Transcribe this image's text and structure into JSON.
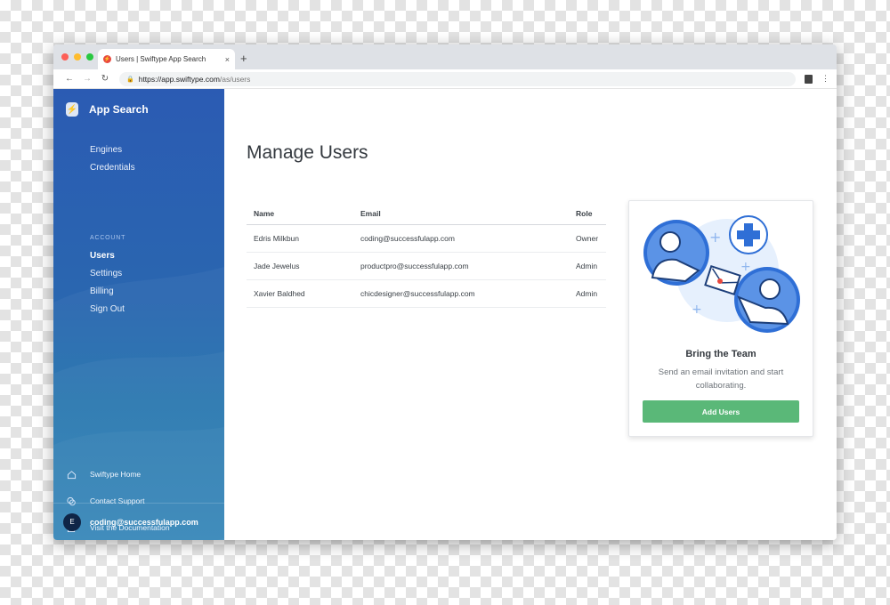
{
  "browser": {
    "tab_title": "Users | Swiftype App Search",
    "tab_close": "×",
    "new_tab": "+",
    "url_host": "https://app.swiftype.com",
    "url_path": "/as/users"
  },
  "sidebar": {
    "brand": "App Search",
    "brand_icon": "⚡",
    "primary": [
      {
        "label": "Engines"
      },
      {
        "label": "Credentials"
      }
    ],
    "section_label": "ACCOUNT",
    "account": [
      {
        "label": "Users",
        "active": true
      },
      {
        "label": "Settings"
      },
      {
        "label": "Billing"
      },
      {
        "label": "Sign Out"
      }
    ],
    "links": [
      {
        "label": "Swiftype Home",
        "icon": "home-icon"
      },
      {
        "label": "Contact Support",
        "icon": "chat-icon"
      },
      {
        "label": "Visit the Documentation",
        "icon": "documentation-icon"
      }
    ],
    "user": {
      "initial": "E",
      "email": "coding@successfulapp.com"
    }
  },
  "main": {
    "title": "Manage Users",
    "table": {
      "headers": [
        "Name",
        "Email",
        "Role"
      ],
      "rows": [
        [
          "Edris Milkbun",
          "coding@successfulapp.com",
          "Owner"
        ],
        [
          "Jade Jewelus",
          "productpro@successfulapp.com",
          "Admin"
        ],
        [
          "Xavier Baldhed",
          "chicdesigner@successfulapp.com",
          "Admin"
        ]
      ]
    },
    "card": {
      "title": "Bring the Team",
      "description": "Send an email invitation and start collaborating.",
      "button": "Add Users"
    }
  },
  "colors": {
    "sidebar": "#2b5bb3",
    "accent_button": "#5ab878",
    "illustration_blue": "#2f6fd6"
  }
}
